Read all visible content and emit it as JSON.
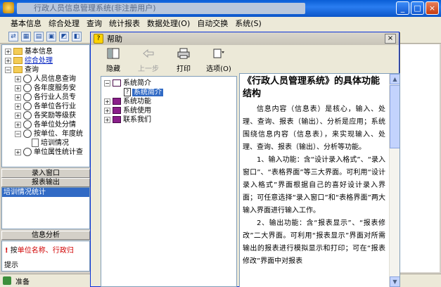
{
  "main_window": {
    "title": "行政人员信息管理系统(非注册用户)",
    "minimize": "_",
    "maximize": "□",
    "close": "×"
  },
  "menu": [
    "基本信息",
    "综合处理",
    "查询",
    "统计报表",
    "数据处理(O)",
    "自动交换",
    "系统(S)"
  ],
  "toolbar_icons": [
    "export-icon",
    "grid-icon",
    "table-icon",
    "image-icon",
    "chart-icon",
    "app-icon"
  ],
  "left_tree": {
    "items": [
      {
        "label": "基本信息",
        "expander": "+"
      },
      {
        "label": "综合处理",
        "expander": "+"
      },
      {
        "label": "查询",
        "expander": "−"
      },
      {
        "label": "人员信息查询",
        "expander": "+"
      },
      {
        "label": "各年度服务安",
        "expander": "+"
      },
      {
        "label": "各行业人员专",
        "expander": "+"
      },
      {
        "label": "各单位各行业",
        "expander": "+"
      },
      {
        "label": "各奖励等级获",
        "expander": "+"
      },
      {
        "label": "各单位处分情",
        "expander": "+"
      },
      {
        "label": "按单位、年度统",
        "expander": "−"
      },
      {
        "label": "培训情况",
        "expander": ""
      },
      {
        "label": "单位属性统计查",
        "expander": "+"
      }
    ]
  },
  "sections": {
    "entry_window": "录入窗口",
    "report_output": "报表输出",
    "report_selected": "培训情况统计",
    "info_analysis": "信息分析"
  },
  "info_panel": {
    "prefix": "按",
    "highlight": "单位名称、行政归",
    "hint": "提示"
  },
  "status": "准备",
  "help": {
    "title": "帮助",
    "close": "×",
    "tools": [
      {
        "label": "隐藏",
        "enabled": true
      },
      {
        "label": "上一步",
        "enabled": false
      },
      {
        "label": "打印",
        "enabled": true
      },
      {
        "label": "选项(O)",
        "enabled": true
      }
    ],
    "toc": [
      {
        "label": "系统简介",
        "expander": "−"
      },
      {
        "label": "系统简介",
        "expander": ""
      },
      {
        "label": "系统功能",
        "expander": "+"
      },
      {
        "label": "系统使用",
        "expander": "+"
      },
      {
        "label": "联系我们",
        "expander": "+"
      }
    ],
    "content": {
      "heading": "《行政人员管理系统》的具体功能结构",
      "paragraphs": [
        "信息内容（信息表）是核心，输入、处理、查询、报表（输出）、分析是应用；系统围绕信息内容（信息表），来实现输入、处理、查询、报表（输出）、分析等功能。",
        "1、输入功能：含“设计录入格式”、“录入窗口”、“表格界面”等三大界面。可利用“设计录入格式”界面根据自己的喜好设计录入界面；可任意选择“录入窗口”和“表格界面”两大输入界面进行输入工作。",
        "2、输出功能：含“报表显示”、“报表修改”二大界面。可利用“报表显示”界面对所需输出的报表进行模拟显示和打印；可在“报表修改”界面中对报表"
      ]
    }
  }
}
